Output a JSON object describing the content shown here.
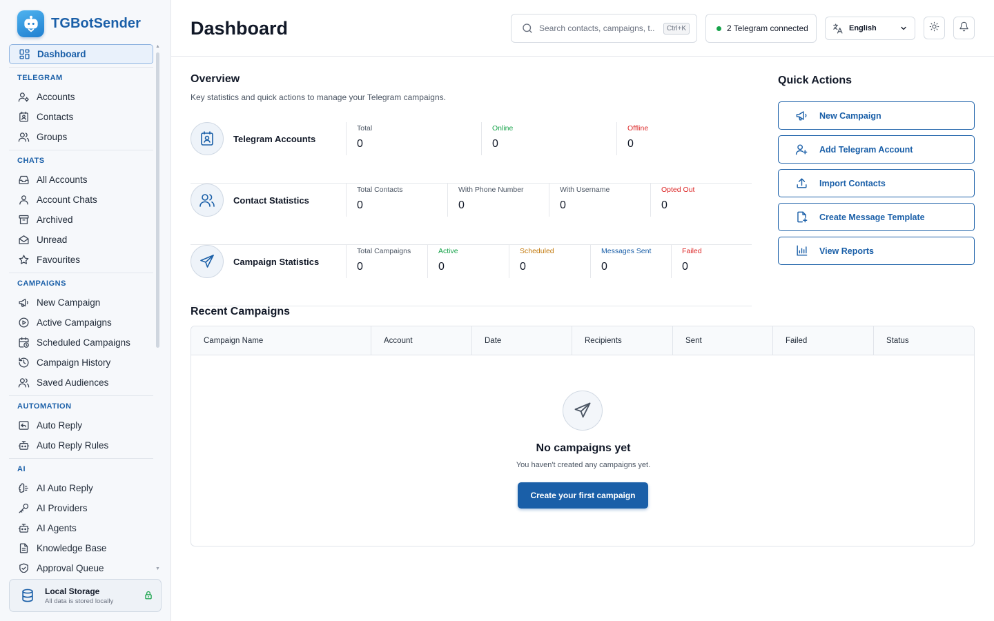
{
  "app": {
    "name": "TGBotSender"
  },
  "sidebar": {
    "dashboard": "Dashboard",
    "sections": {
      "telegram": "TELEGRAM",
      "chats": "CHATS",
      "campaigns": "CAMPAIGNS",
      "automation": "AUTOMATION",
      "ai": "AI"
    },
    "telegram": [
      "Accounts",
      "Contacts",
      "Groups"
    ],
    "chats": [
      "All Accounts",
      "Account Chats",
      "Archived",
      "Unread",
      "Favourites"
    ],
    "campaigns": [
      "New Campaign",
      "Active Campaigns",
      "Scheduled Campaigns",
      "Campaign History",
      "Saved Audiences"
    ],
    "automation": [
      "Auto Reply",
      "Auto Reply Rules"
    ],
    "ai": [
      "AI Auto Reply",
      "AI Providers",
      "AI Agents",
      "Knowledge Base",
      "Approval Queue"
    ],
    "storage": {
      "title": "Local Storage",
      "subtitle": "All data is stored locally"
    }
  },
  "header": {
    "title": "Dashboard",
    "search_placeholder": "Search contacts, campaigns, t...",
    "search_shortcut": "Ctrl+K",
    "telegram_status": "2 Telegram connected",
    "language": "English"
  },
  "overview": {
    "title": "Overview",
    "subtitle": "Key statistics and quick actions to manage your Telegram campaigns.",
    "accounts": {
      "label": "Telegram Accounts",
      "stats": [
        {
          "key": "Total",
          "value": "0"
        },
        {
          "key": "Online",
          "value": "0"
        },
        {
          "key": "Offline",
          "value": "0"
        }
      ]
    },
    "contacts": {
      "label": "Contact Statistics",
      "stats": [
        {
          "key": "Total Contacts",
          "value": "0"
        },
        {
          "key": "With Phone Number",
          "value": "0"
        },
        {
          "key": "With Username",
          "value": "0"
        },
        {
          "key": "Opted Out",
          "value": "0"
        }
      ]
    },
    "campaigns": {
      "label": "Campaign Statistics",
      "stats": [
        {
          "key": "Total Campaigns",
          "value": "0"
        },
        {
          "key": "Active",
          "value": "0"
        },
        {
          "key": "Scheduled",
          "value": "0"
        },
        {
          "key": "Messages Sent",
          "value": "0"
        },
        {
          "key": "Failed",
          "value": "0"
        }
      ]
    }
  },
  "quick_actions": {
    "title": "Quick Actions",
    "items": [
      "New Campaign",
      "Add Telegram Account",
      "Import Contacts",
      "Create Message Template",
      "View Reports"
    ]
  },
  "recent_campaigns": {
    "title": "Recent Campaigns",
    "columns": [
      "Campaign Name",
      "Account",
      "Date",
      "Recipients",
      "Sent",
      "Failed",
      "Status"
    ],
    "empty_title": "No campaigns yet",
    "empty_subtitle": "You haven't created any campaigns yet.",
    "cta": "Create your first campaign"
  },
  "colors": {
    "brand": "#1a5fa8",
    "online": "#16a34a",
    "offline": "#dc2626",
    "scheduled": "#c2780a"
  }
}
